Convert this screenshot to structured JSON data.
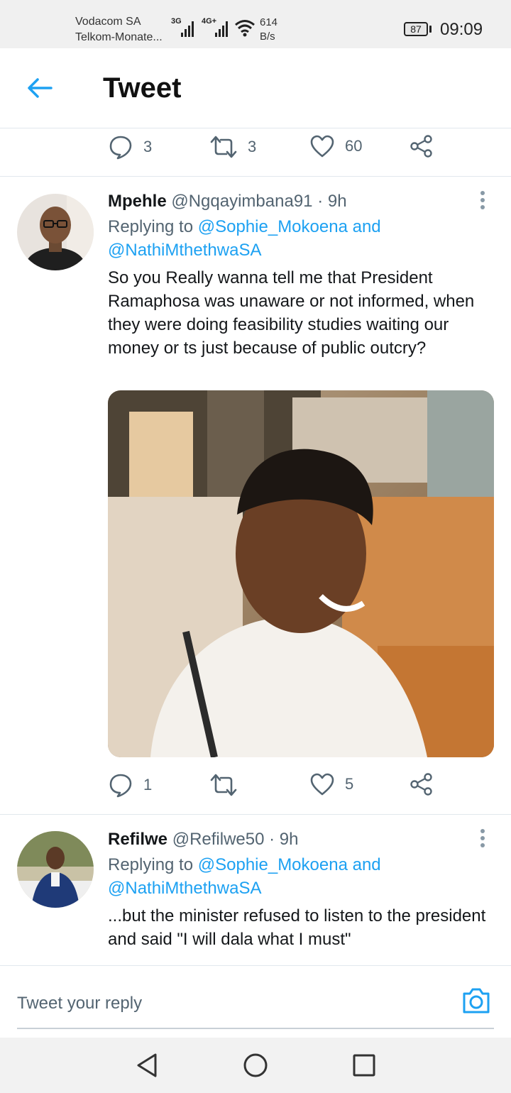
{
  "status_bar": {
    "carrier1": "Vodacom SA",
    "carrier2": "Telkom-Monate...",
    "net1": "3G",
    "net2": "4G+",
    "speed_value": "614",
    "speed_unit": "B/s",
    "battery": "87",
    "time": "09:09"
  },
  "header": {
    "title": "Tweet",
    "back_icon": "arrow-left-icon"
  },
  "main_tweet_actions": {
    "replies": "3",
    "retweets": "3",
    "likes": "60"
  },
  "tweets": [
    {
      "name": "Mpehle",
      "handle": "@Ngqayimbana91",
      "time": "· 9h",
      "replying_prefix": "Replying to",
      "mention1": "@Sophie_Mokoena",
      "and": "and",
      "mention2": "@NathiMthethwaSA",
      "text": "So you Really wanna tell me that President Ramaphosa was unaware or not informed, when they were doing feasibility studies waiting our money or ts just because of public outcry?",
      "replies": "1",
      "retweets": "",
      "likes": "5"
    },
    {
      "name": "Refilwe",
      "handle": "@Refilwe50",
      "time": "· 9h",
      "replying_prefix": "Replying to",
      "mention1": "@Sophie_Mokoena",
      "and": "and",
      "mention2": "@NathiMthethwaSA",
      "text": "...but the minister refused to listen to the president and said \"I will dala what I must\""
    }
  ],
  "reply_box": {
    "placeholder": "Tweet your reply"
  },
  "colors": {
    "accent": "#1da1f2",
    "secondary_text": "#536471",
    "divider": "#e1e8ed"
  }
}
